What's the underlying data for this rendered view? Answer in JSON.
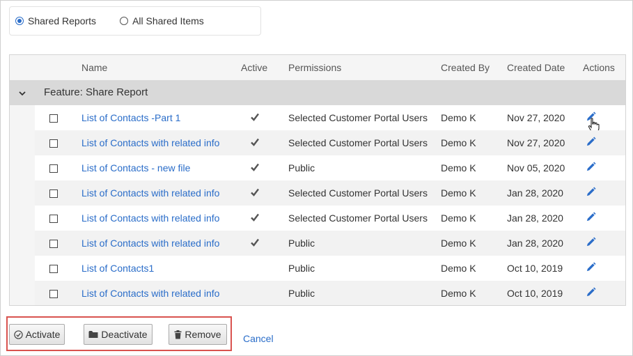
{
  "filter": {
    "options": [
      {
        "label": "Shared Reports",
        "checked": true
      },
      {
        "label": "All Shared Items",
        "checked": false
      }
    ]
  },
  "grid": {
    "columns": [
      "Name",
      "Active",
      "Permissions",
      "Created By",
      "Created Date",
      "Actions"
    ],
    "group": {
      "title": "Feature: Share Report",
      "expanded": true
    },
    "rows": [
      {
        "name": "List of Contacts -Part 1",
        "active": true,
        "permissions": "Selected Customer Portal Users",
        "created_by": "Demo K",
        "created_date": "Nov 27, 2020"
      },
      {
        "name": "List of Contacts with related info",
        "active": true,
        "permissions": "Selected Customer Portal Users",
        "created_by": "Demo K",
        "created_date": "Nov 27, 2020"
      },
      {
        "name": "List of Contacts - new file",
        "active": true,
        "permissions": "Public",
        "created_by": "Demo K",
        "created_date": "Nov 05, 2020"
      },
      {
        "name": "List of Contacts with related info",
        "active": true,
        "permissions": "Selected Customer Portal Users",
        "created_by": "Demo K",
        "created_date": "Jan 28, 2020"
      },
      {
        "name": "List of Contacts with related info",
        "active": true,
        "permissions": "Selected Customer Portal Users",
        "created_by": "Demo K",
        "created_date": "Jan 28, 2020"
      },
      {
        "name": "List of Contacts with related info",
        "active": true,
        "permissions": "Public",
        "created_by": "Demo K",
        "created_date": "Jan 28, 2020"
      },
      {
        "name": "List of Contacts1",
        "active": false,
        "permissions": "Public",
        "created_by": "Demo K",
        "created_date": "Oct 10, 2019"
      },
      {
        "name": "List of Contacts with related info",
        "active": false,
        "permissions": "Public",
        "created_by": "Demo K",
        "created_date": "Oct 10, 2019"
      }
    ],
    "icons": {
      "row_action": "pencil-icon",
      "active_mark": "checkmark-icon",
      "group_toggle": "chevron-down-icon"
    }
  },
  "actions": {
    "activate_label": "Activate",
    "deactivate_label": "Deactivate",
    "remove_label": "Remove",
    "cancel_label": "Cancel",
    "icons": {
      "activate": "check-circle-icon",
      "deactivate": "folder-icon",
      "remove": "trash-icon"
    }
  },
  "colors": {
    "link": "#2a6dc9",
    "highlight_border": "#d9534f",
    "group_band": "#d9d9d9"
  }
}
